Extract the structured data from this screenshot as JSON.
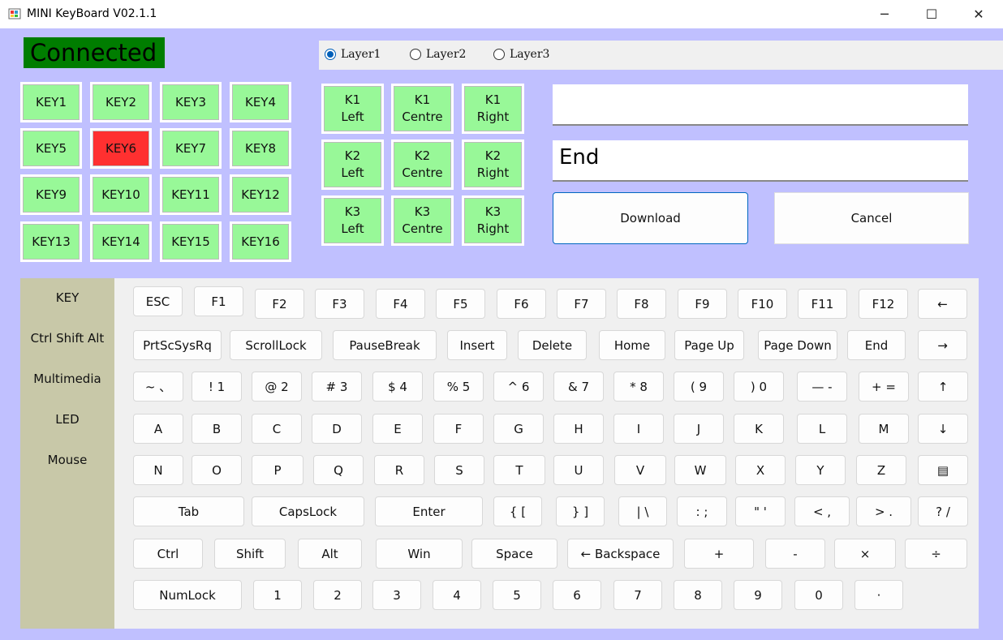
{
  "window": {
    "title": "MINI KeyBoard V02.1.1",
    "icon": "app-icon",
    "controls": {
      "minimize": "─",
      "maximize": "☐",
      "close": "✕"
    }
  },
  "status": {
    "connected": "Connected"
  },
  "layers": [
    {
      "label": "Layer1",
      "selected": true
    },
    {
      "label": "Layer2",
      "selected": false
    },
    {
      "label": "Layer3",
      "selected": false
    }
  ],
  "keys": [
    "KEY1",
    "KEY2",
    "KEY3",
    "KEY4",
    "KEY5",
    "KEY6",
    "KEY7",
    "KEY8",
    "KEY9",
    "KEY10",
    "KEY11",
    "KEY12",
    "KEY13",
    "KEY14",
    "KEY15",
    "KEY16"
  ],
  "active_key": "KEY6",
  "colors": {
    "key_green": "#98f898",
    "key_active": "#ff3030",
    "connected_bg": "#007d00",
    "background": "#c0c0ff"
  },
  "knobs": [
    {
      "line1": "K1",
      "line2": "Left"
    },
    {
      "line1": "K1",
      "line2": "Centre"
    },
    {
      "line1": "K1",
      "line2": "Right"
    },
    {
      "line1": "K2",
      "line2": "Left"
    },
    {
      "line1": "K2",
      "line2": "Centre"
    },
    {
      "line1": "K2",
      "line2": "Right"
    },
    {
      "line1": "K3",
      "line2": "Left"
    },
    {
      "line1": "K3",
      "line2": "Centre"
    },
    {
      "line1": "K3",
      "line2": "Right"
    }
  ],
  "fields": {
    "field1": "",
    "field2": "End"
  },
  "buttons": {
    "download": "Download",
    "cancel": "Cancel"
  },
  "sidebar": [
    "KEY",
    "Ctrl Shift Alt",
    "Multimedia",
    "LED",
    "Mouse"
  ],
  "keyboard": {
    "row1": [
      "ESC",
      "F1",
      "F2",
      "F3",
      "F4",
      "F5",
      "F6",
      "F7",
      "F8",
      "F9",
      "F10",
      "F11",
      "F12",
      "←"
    ],
    "row2": [
      "PrtScSysRq",
      "ScrollLock",
      "PauseBreak",
      "Insert",
      "Delete",
      "Home",
      "Page Up",
      "Page Down",
      "End",
      "→"
    ],
    "row3": [
      "~ 、",
      "! 1",
      "@ 2",
      "# 3",
      "$ 4",
      "% 5",
      "^ 6",
      "& 7",
      "* 8",
      "( 9",
      ") 0",
      "— -",
      "+ =",
      "↑"
    ],
    "row4": [
      "A",
      "B",
      "C",
      "D",
      "E",
      "F",
      "G",
      "H",
      "I",
      "J",
      "K",
      "L",
      "M",
      "↓"
    ],
    "row5": [
      "N",
      "O",
      "P",
      "Q",
      "R",
      "S",
      "T",
      "U",
      "V",
      "W",
      "X",
      "Y",
      "Z",
      "▤"
    ],
    "row6": [
      "Tab",
      "CapsLock",
      "Enter",
      "{ [",
      "} ]",
      "| \\",
      ": ;",
      "\" '",
      "< ,",
      "> .",
      "? /"
    ],
    "row7": [
      "Ctrl",
      "Shift",
      "Alt",
      "Win",
      "Space",
      "← Backspace",
      "+",
      "-",
      "×",
      "÷"
    ],
    "row8": [
      "NumLock",
      "1",
      "2",
      "3",
      "4",
      "5",
      "6",
      "7",
      "8",
      "9",
      "0",
      "·"
    ]
  }
}
